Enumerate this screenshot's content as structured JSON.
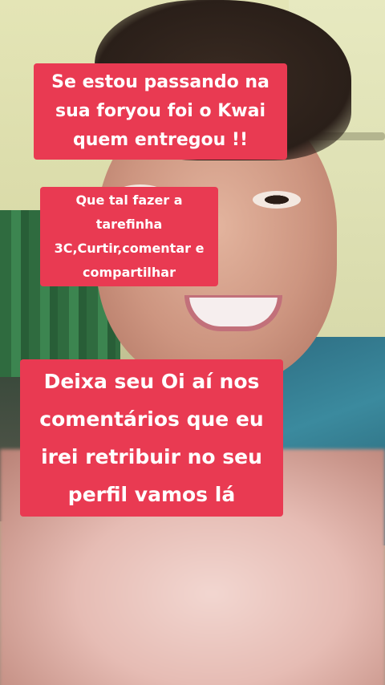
{
  "captions": {
    "top": "Se estou passando na\nsua foryou foi o Kwai\nquem entregou !!",
    "middle": "Que tal fazer a\ntarefinha\n3C,Curtir,comentar e\ncompartilhar",
    "bottom": "Deixa seu Oi aí nos\ncomentários que eu\nirei retribuir no seu\nperfil vamos lá"
  },
  "colors": {
    "caption_background": "#e93a52",
    "caption_text": "#ffffff"
  }
}
